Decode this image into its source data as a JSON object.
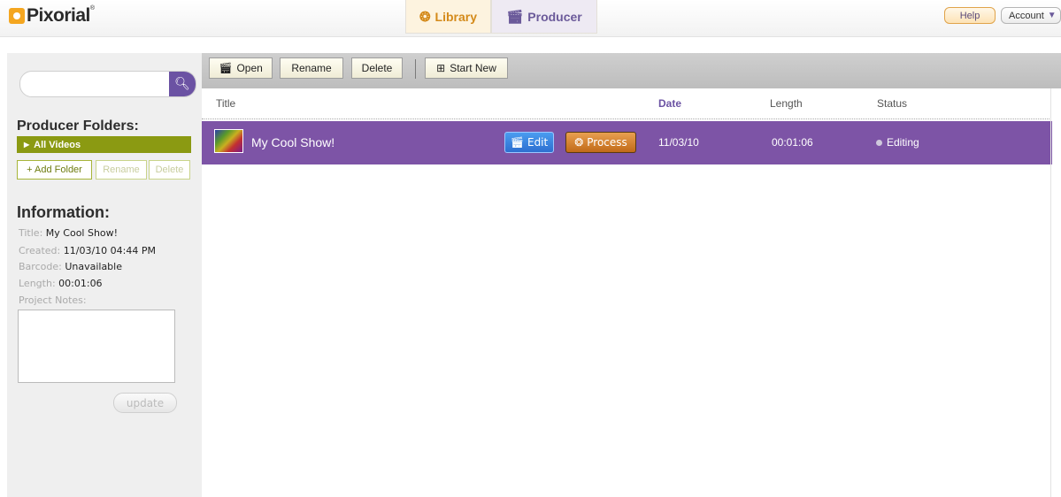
{
  "brand": {
    "name": "Pixorial",
    "mark": "®"
  },
  "nav": {
    "tabs": [
      {
        "label": "Library",
        "icon": "film-reel-icon"
      },
      {
        "label": "Producer",
        "icon": "clapboard-icon"
      }
    ],
    "help_label": "Help",
    "account_label": "Account"
  },
  "search": {
    "value": "",
    "placeholder": ""
  },
  "sidebar": {
    "folders_heading": "Producer Folders:",
    "folders": [
      {
        "label": "All Videos",
        "selected": true
      }
    ],
    "add_folder_label": "+ Add Folder",
    "rename_label": "Rename",
    "delete_label": "Delete",
    "info_heading": "Information:",
    "info": {
      "title_label": "Title:",
      "title_value": "My Cool Show!",
      "created_label": "Created:",
      "created_value": "11/03/10 04:44 PM",
      "barcode_label": "Barcode:",
      "barcode_value": "Unavailable",
      "length_label": "Length:",
      "length_value": "00:01:06",
      "notes_label": "Project Notes:",
      "notes_value": ""
    },
    "update_label": "update"
  },
  "toolbar": {
    "open_label": "Open",
    "rename_label": "Rename",
    "delete_label": "Delete",
    "start_new_label": "Start New"
  },
  "table": {
    "columns": {
      "title": "Title",
      "date": "Date",
      "length": "Length",
      "status": "Status"
    },
    "rows": [
      {
        "title": "My Cool Show!",
        "edit_label": "Edit",
        "process_label": "Process",
        "date": "11/03/10",
        "length": "00:01:06",
        "status": "Editing",
        "selected": true
      }
    ]
  },
  "colors": {
    "brand_orange": "#f4a620",
    "accent_purple": "#7d54a6",
    "folder_green": "#8b9a12",
    "edit_blue": "#2d6fd0",
    "process_orange": "#c16a18"
  }
}
